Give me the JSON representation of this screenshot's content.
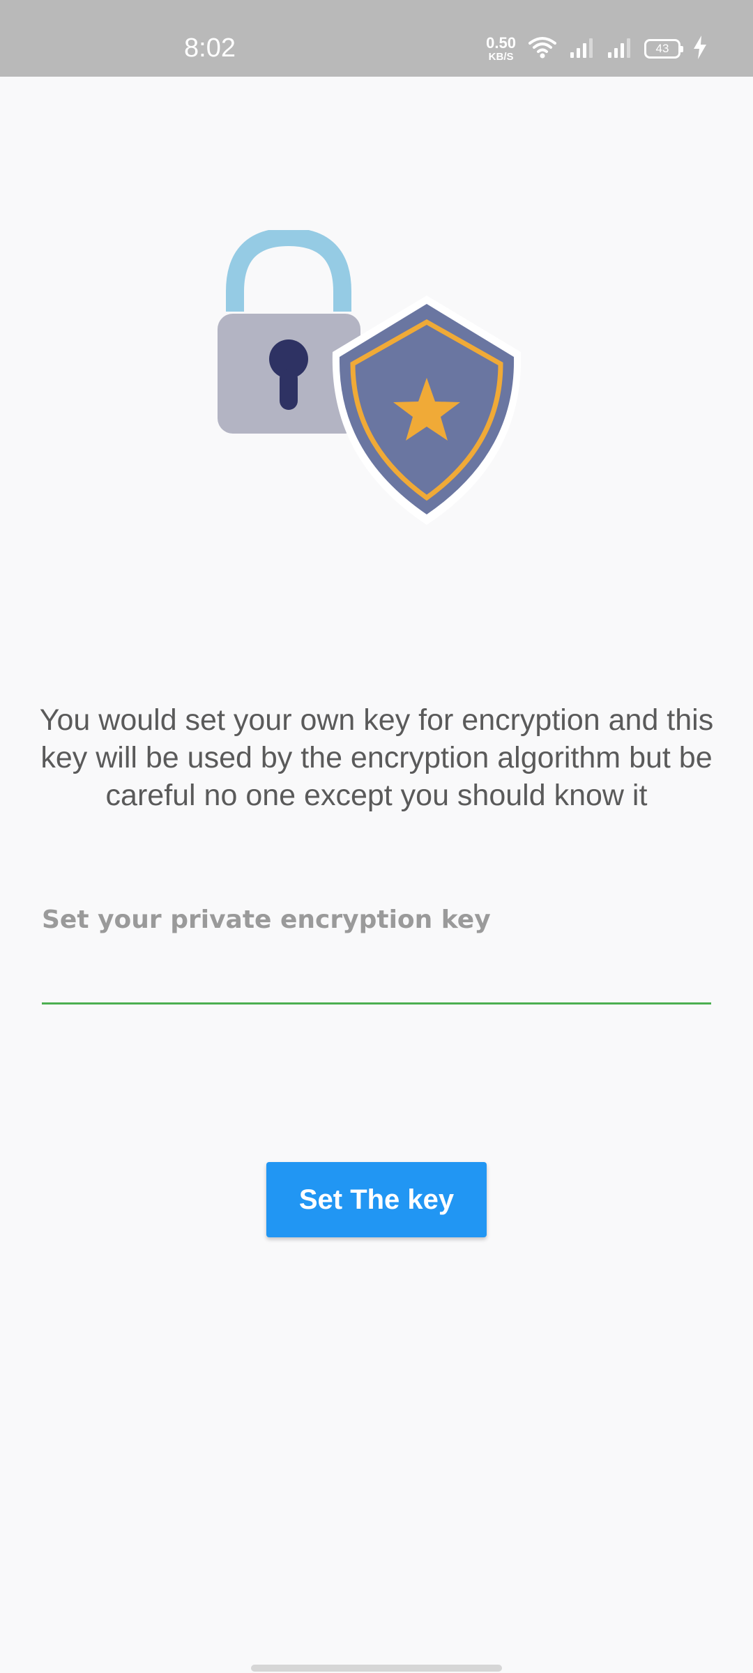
{
  "status_bar": {
    "time": "8:02",
    "net_speed_value": "0.50",
    "net_speed_unit": "KB/S",
    "battery_level": "43",
    "icons": [
      "wifi-icon",
      "signal-icon",
      "signal-icon",
      "battery-icon",
      "charging-icon"
    ]
  },
  "hero": {
    "icons": [
      "padlock-icon",
      "shield-icon",
      "star-icon"
    ],
    "colors": {
      "shackle": "#95cbe4",
      "lock_body": "#b3b4c3",
      "keyhole": "#2e3263",
      "shield": "#6a76a1",
      "shield_trim": "#f0aa37",
      "star": "#f0aa37"
    }
  },
  "main": {
    "description": "You would set your own key for encryption and this key will be used by the encryption algorithm but be careful no one except you should know it",
    "key_input": {
      "placeholder": "Set your private encryption key",
      "value": ""
    },
    "submit_label": "Set The key"
  },
  "colors": {
    "accent": "#2196f3",
    "input_underline": "#4caf50",
    "status_bar": "#b9b9b9",
    "background": "#f9f9fa"
  }
}
